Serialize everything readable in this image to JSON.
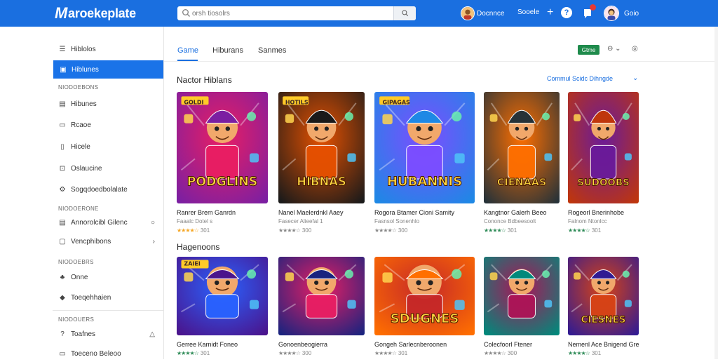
{
  "header": {
    "logo_mark": "M",
    "logo_text": "aroekeplate",
    "search_placeholder": "orsh tiosolrs",
    "user_name": "Docnnce",
    "link_text": "Sooele",
    "plus": "+",
    "help": "?",
    "user2_name": "Goio"
  },
  "sidebar": {
    "items": [
      {
        "label": "Hiblolos",
        "icon": "list-icon",
        "glyph": "☰"
      },
      {
        "label": "Hiblunes",
        "icon": "image-icon",
        "glyph": "▣"
      },
      {
        "label": "Hibunes",
        "icon": "gamepad-icon",
        "glyph": "▤"
      },
      {
        "label": "Rcaoe",
        "icon": "inbox-icon",
        "glyph": "▭"
      },
      {
        "label": "Hicele",
        "icon": "file-icon",
        "glyph": "▯"
      },
      {
        "label": "Oslaucine",
        "icon": "download-icon",
        "glyph": "⊡"
      },
      {
        "label": "Sogqdoedbolalate",
        "icon": "settings-icon",
        "glyph": "⚙"
      },
      {
        "label": "Annorolcibl Gilenc",
        "icon": "grid-icon",
        "glyph": "▤",
        "right": "○"
      },
      {
        "label": "Vencphibons",
        "icon": "storefront-icon",
        "glyph": "▢",
        "right": "›"
      },
      {
        "label": "Onne",
        "icon": "people-icon",
        "glyph": "♣"
      },
      {
        "label": "Toeqehhaien",
        "icon": "shield-icon",
        "glyph": "◆"
      },
      {
        "label": "Toafnes",
        "icon": "help-icon",
        "glyph": "?",
        "right": "△"
      },
      {
        "label": "Toeceno Beleoo",
        "icon": "wallet-icon",
        "glyph": "▭"
      }
    ],
    "headings": [
      "NIODOEBONS",
      "NIODOERONE",
      "NIODOEBRS",
      "NIODOUERS"
    ]
  },
  "tabs": [
    "Game",
    "Hiburans",
    "Sanmes"
  ],
  "toolbar": {
    "pill": "Gtme",
    "ctl1": "⊖ ⌄",
    "ctl2": "◎"
  },
  "sections": [
    {
      "title": "Nactor Hiblans",
      "link": "Commul Scidc Dihngde",
      "chevron": "⌄",
      "cards": [
        {
          "art": "PODGLINS",
          "tag": "GOLDI",
          "title": "Ranrer Brem Ganrdn",
          "sub": "Faaalc Dotel s",
          "stars": "★★★★☆",
          "rating": "301",
          "star_color": "#f5a623",
          "bg1": "#7b1fa2",
          "bg2": "#e91e63"
        },
        {
          "art": "HIBNAS",
          "tag": "HOTILS",
          "title": "Nanel Maelerdnkl Aaey",
          "sub": "Fasecer Alieefal 1",
          "stars": "★★★★☆",
          "rating": "300",
          "star_color": "#888888",
          "bg1": "#1a1a1a",
          "bg2": "#e65100"
        },
        {
          "art": "HUBANNIS",
          "tag": "GIPAGAS",
          "title": "Rogora Btamer Cioni Samity",
          "sub": "Fasnsol Sonenhlo",
          "stars": "★★★★☆",
          "rating": "300",
          "star_color": "#888888",
          "bg1": "#1e88e5",
          "bg2": "#7c4dff"
        },
        {
          "art": "CIENAAS",
          "tag": "",
          "title": "Kangtnor Galerh Beeo",
          "sub": "Cononce Bdbeesoolt",
          "stars": "★★★★☆",
          "rating": "301",
          "star_color": "#2e8b57",
          "bg1": "#263238",
          "bg2": "#ff6f00"
        },
        {
          "art": "SUDOOBS",
          "tag": "",
          "title": "Rogeorl Bnerinhobe",
          "sub": "Falnom Ntonlcc",
          "stars": "★★★★☆",
          "rating": "301",
          "star_color": "#2e8b57",
          "bg1": "#bf360c",
          "bg2": "#6a1b9a"
        }
      ]
    },
    {
      "title": "Hagenoons",
      "cards": [
        {
          "art": "",
          "tag": "ZAIEI",
          "title": "Gerree Karnidt Foneo",
          "sub": "",
          "stars": "★★★★☆",
          "rating": "301",
          "star_color": "#2e8b57",
          "bg1": "#4a148c",
          "bg2": "#2962ff"
        },
        {
          "art": "",
          "tag": "",
          "title": "Gonoenbeogierra",
          "sub": "",
          "stars": "★★★★☆",
          "rating": "300",
          "star_color": "#888888",
          "bg1": "#1a237e",
          "bg2": "#e91e63"
        },
        {
          "art": "SDUGNES",
          "tag": "",
          "title": "Gongeh Sarlecnberoonen",
          "sub": "",
          "stars": "★★★★☆",
          "rating": "301",
          "star_color": "#888888",
          "bg1": "#ff6f00",
          "bg2": "#c62828"
        },
        {
          "art": "",
          "tag": "",
          "title": "Colecfoorl Ftener",
          "sub": "",
          "stars": "★★★★☆",
          "rating": "300",
          "star_color": "#888888",
          "bg1": "#00897b",
          "bg2": "#ad1457"
        },
        {
          "art": "CIESNES",
          "tag": "",
          "title": "Nemenl Ace Bnigend Gre",
          "sub": "",
          "stars": "★★★★☆",
          "rating": "301",
          "star_color": "#2e8b57",
          "bg1": "#311b92",
          "bg2": "#d84315"
        }
      ]
    }
  ],
  "colors": {
    "brand": "#1a6fe0",
    "active": "#1a73e8",
    "pill": "#1f8b4c"
  }
}
